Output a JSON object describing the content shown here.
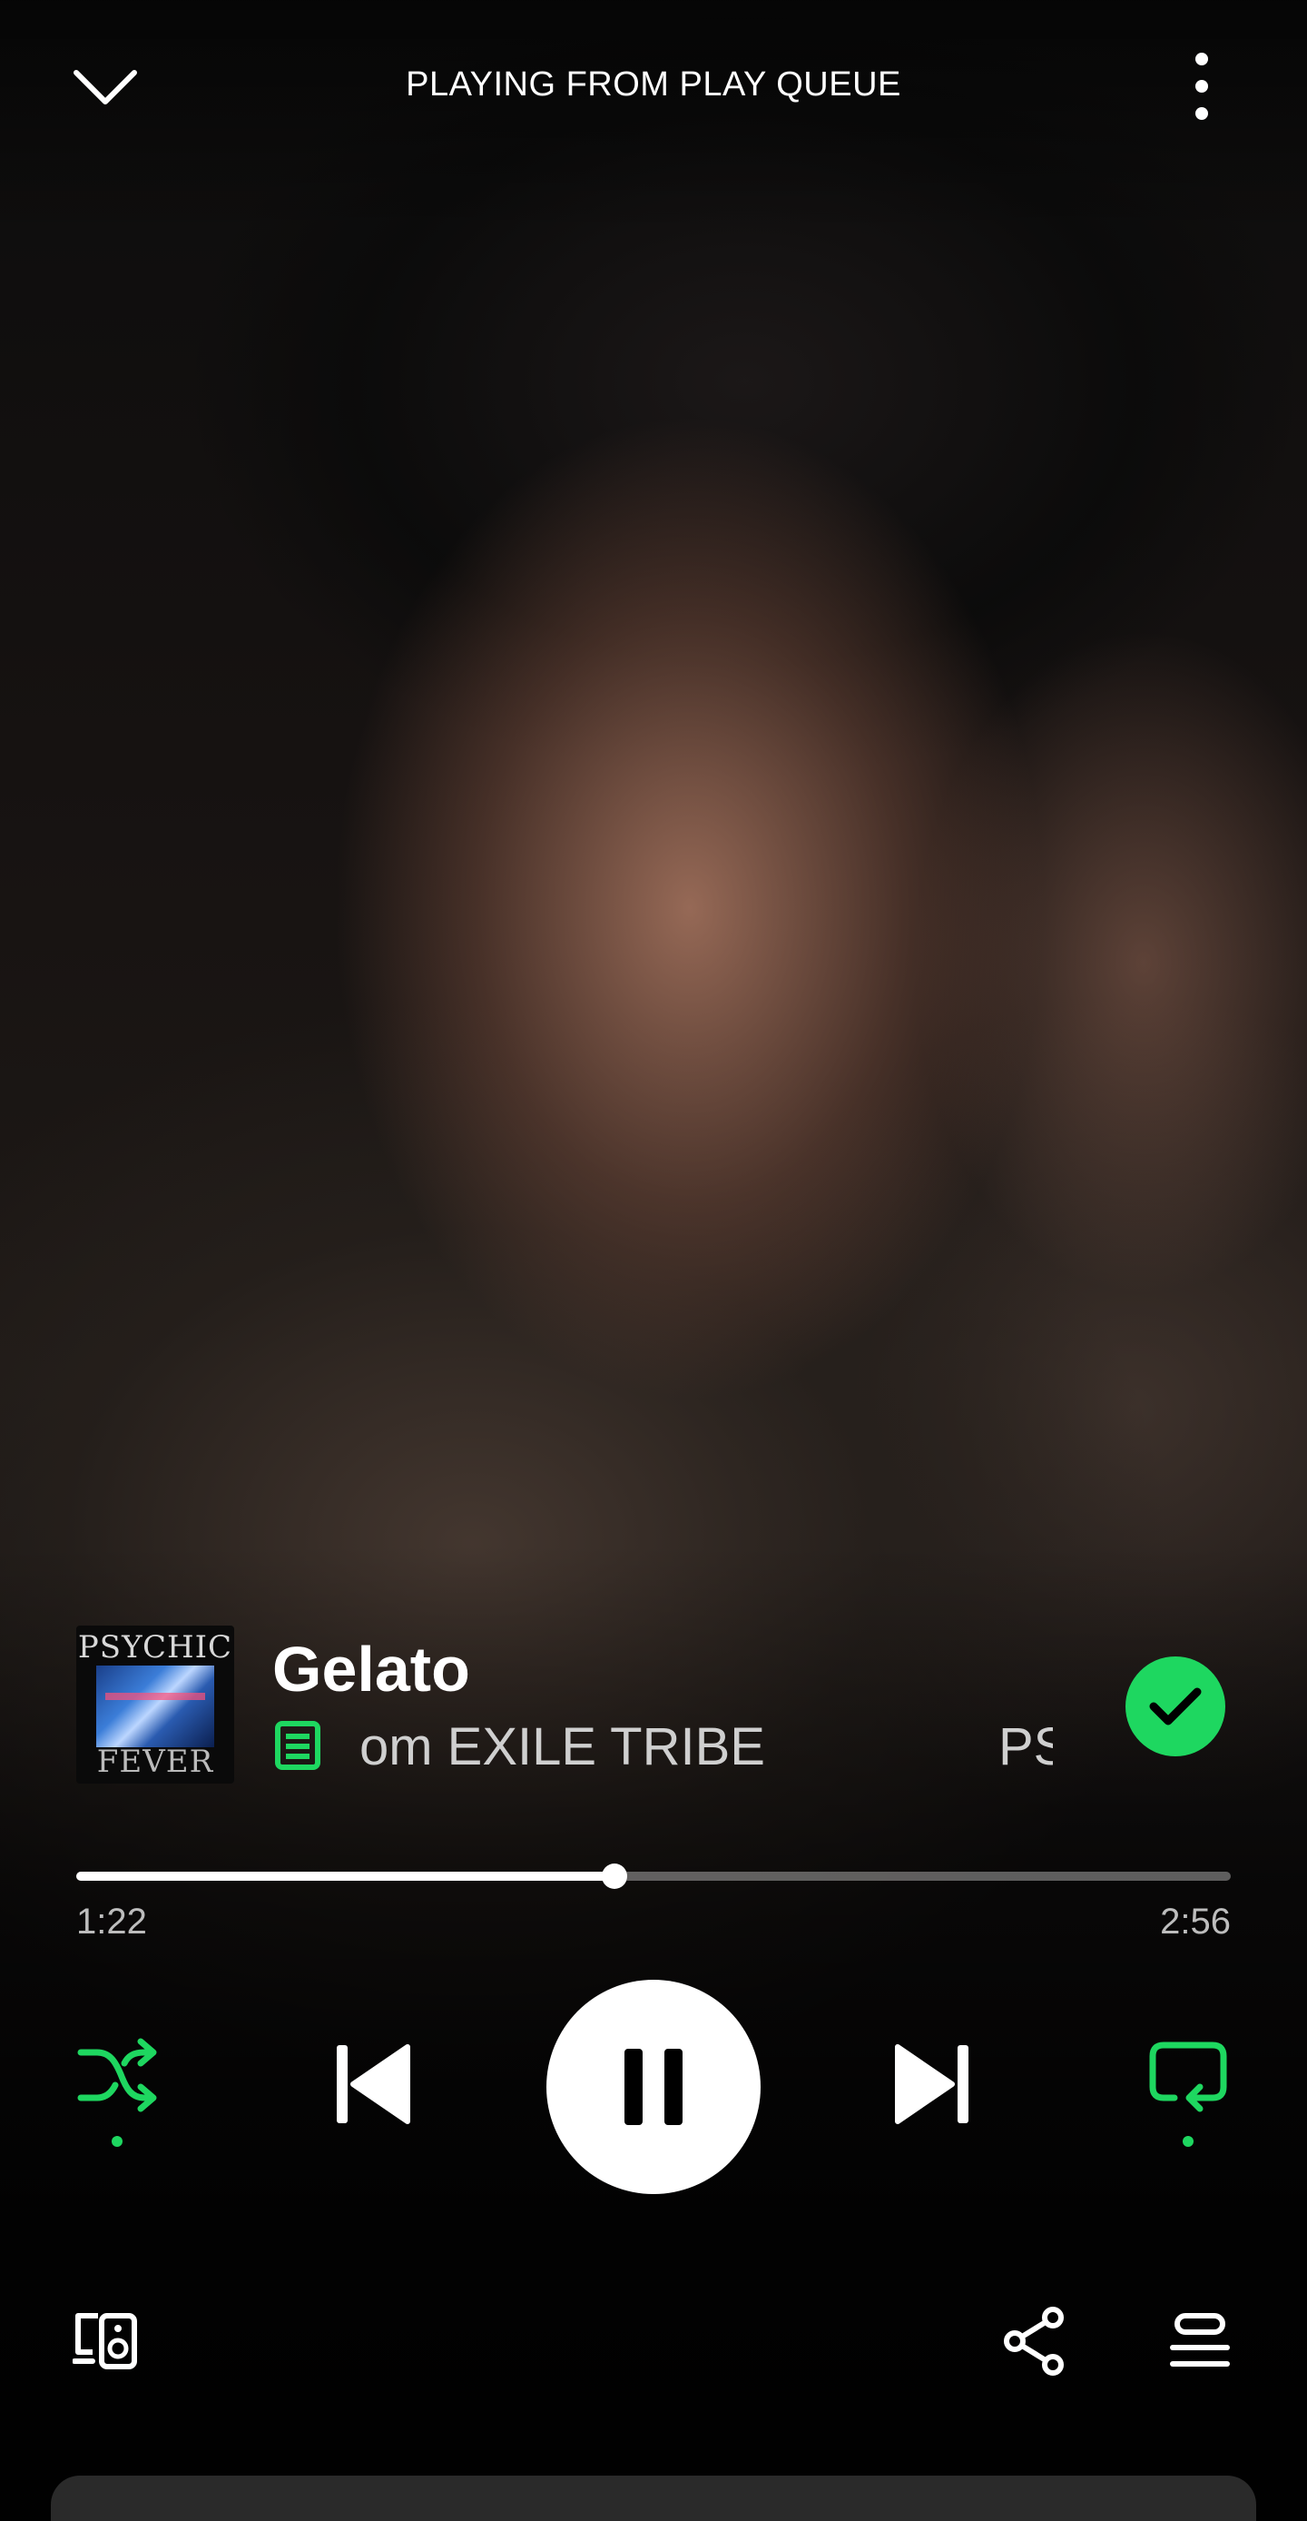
{
  "header": {
    "title": "PLAYING FROM PLAY QUEUE",
    "collapse_icon": "chevron-down-icon",
    "more_icon": "more-vertical-icon"
  },
  "track": {
    "title": "Gelato",
    "artist_marquee": "om EXILE TRIBE",
    "artist_marquee_next": "PS",
    "cover_art": {
      "top_text": "PSYCHIC",
      "bottom_text": "FEVER"
    },
    "saved": true
  },
  "progress": {
    "elapsed": "1:22",
    "total": "2:56",
    "fraction": 0.466
  },
  "controls": {
    "shuffle_active": true,
    "repeat_active": true
  },
  "colors": {
    "accent": "#1ed760",
    "background": "#000000",
    "text": "#ffffff",
    "muted_text": "#bdbdbd"
  },
  "icons": {
    "shuffle": "shuffle-icon",
    "previous": "skip-previous-icon",
    "pause": "pause-icon",
    "next": "skip-next-icon",
    "repeat": "repeat-icon",
    "devices": "connect-device-icon",
    "share": "share-icon",
    "queue": "queue-icon",
    "lyrics": "lyrics-icon",
    "saved": "check-icon"
  }
}
